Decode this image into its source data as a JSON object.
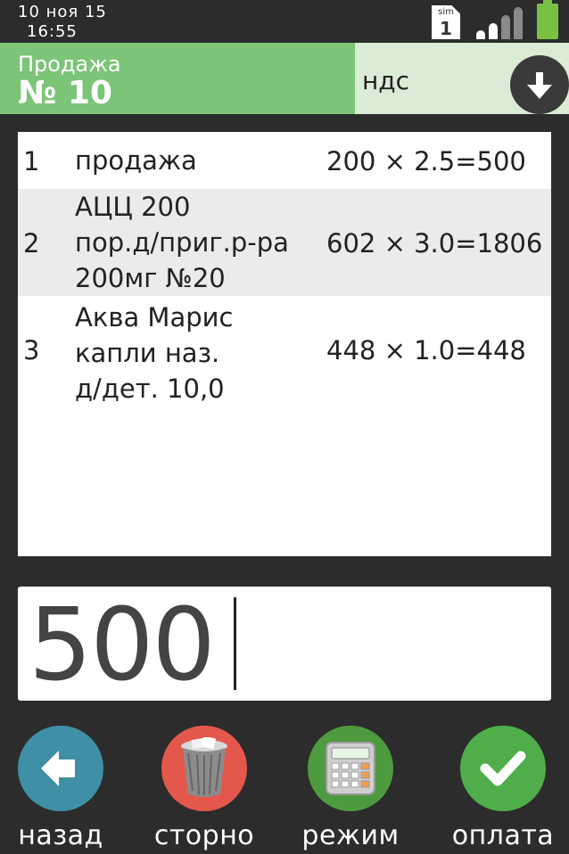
{
  "status_bar": {
    "date": "10 ноя 15",
    "time": "16:55",
    "sim_label": "sim",
    "sim_number": "1",
    "battery_color": "#7ac143"
  },
  "header": {
    "operation": "Продажа",
    "receipt_number": "№ 10",
    "tax_label": "ндс",
    "accent_color": "#7cc477"
  },
  "receipt": {
    "items": [
      {
        "num": "1",
        "name": "продажа",
        "calc": "200 × 2.5=500"
      },
      {
        "num": "2",
        "name": "АЦЦ 200\nпор.д/приг.р-ра\n200мг №20",
        "calc": "602 × 3.0=1806"
      },
      {
        "num": "3",
        "name": " Аква Марис\nкапли наз.\nд/дет. 10,0",
        "calc": "448 × 1.0=448"
      }
    ]
  },
  "input": {
    "value": "500"
  },
  "actions": [
    {
      "id": "back",
      "label": "назад",
      "icon": "arrow-left-icon",
      "color": "#3f8fa6"
    },
    {
      "id": "storno",
      "label": "сторно",
      "icon": "trash-icon",
      "color": "#e4574d"
    },
    {
      "id": "mode",
      "label": "режим",
      "icon": "calculator-icon",
      "color": "#4e9a3f"
    },
    {
      "id": "pay",
      "label": "оплата",
      "icon": "checkmark-icon",
      "color": "#4fae4a"
    }
  ]
}
